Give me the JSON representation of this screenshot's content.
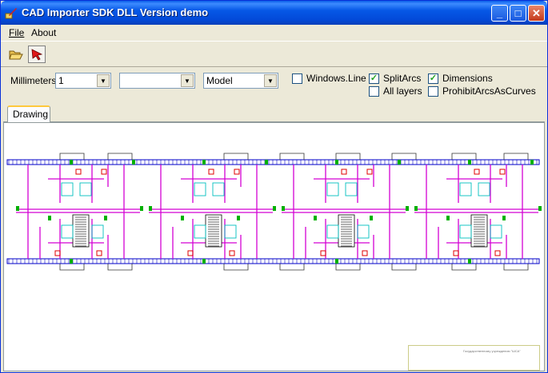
{
  "window": {
    "title": "CAD Importer SDK DLL Version demo"
  },
  "title_buttons": {
    "minimize": "_",
    "maximize": "□",
    "close": "✕"
  },
  "menu": {
    "file": "File",
    "about": "About"
  },
  "toolbar": {
    "open_icon": "folder-open-icon",
    "select_icon": "red-arrow-cursor-icon"
  },
  "options": {
    "units_label": "Millimeters",
    "scale_value": "1",
    "layer_value": "",
    "space_value": "Model",
    "windows_line": {
      "label": "Windows.Line",
      "checked": false
    },
    "split_arcs": {
      "label": "SplitArcs",
      "checked": true
    },
    "dimensions": {
      "label": "Dimensions",
      "checked": true
    },
    "all_layers": {
      "label": "All layers",
      "checked": false
    },
    "prohibit_arcs": {
      "label": "ProhibitArcsAsCurves",
      "checked": false
    }
  },
  "tabs": {
    "drawing": "Drawing"
  },
  "drawing": {
    "stamp_text": "Государственному учреждению \"ШСА\"",
    "colors": {
      "walls": "#d400d4",
      "grid": "#0000c8",
      "hatch": "#00c0c0",
      "marks": "#e00000",
      "doors": "#00b000"
    }
  }
}
